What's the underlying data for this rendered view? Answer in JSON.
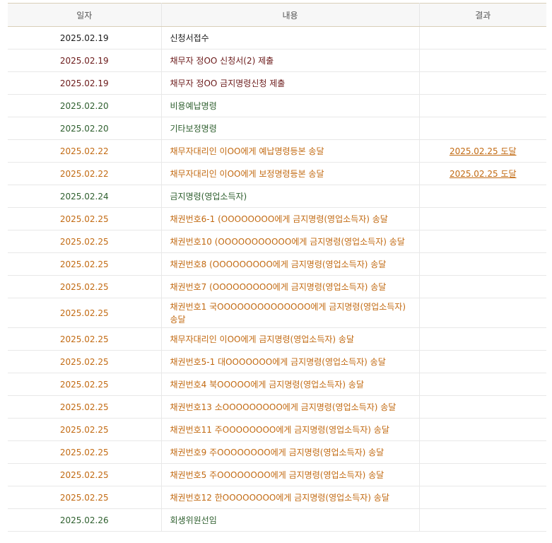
{
  "headers": {
    "date": "일자",
    "content": "내용",
    "result": "결과"
  },
  "colors": {
    "black": "#1c1c1c",
    "maroon": "#6b1a1a",
    "green": "#2e5f2e",
    "orange": "#c26a12"
  },
  "rows": [
    {
      "date": "2025.02.19",
      "content": "신청서접수",
      "result": "",
      "color": "#1c1c1c"
    },
    {
      "date": "2025.02.19",
      "content": "채무자 정OO 신청서(2) 제출",
      "result": "",
      "color": "#6b1a1a"
    },
    {
      "date": "2025.02.19",
      "content": "채무자 정OO 금지명령신청 제출",
      "result": "",
      "color": "#6b1a1a"
    },
    {
      "date": "2025.02.20",
      "content": "비용예납명령",
      "result": "",
      "color": "#2e5f2e"
    },
    {
      "date": "2025.02.20",
      "content": "기타보정명령",
      "result": "",
      "color": "#2e5f2e"
    },
    {
      "date": "2025.02.22",
      "content": "채무자대리인 이OO에게 예납명령등본 송달",
      "result": "2025.02.25 도달",
      "color": "#c26a12"
    },
    {
      "date": "2025.02.22",
      "content": "채무자대리인 이OO에게 보정명령등본 송달",
      "result": "2025.02.25 도달",
      "color": "#c26a12"
    },
    {
      "date": "2025.02.24",
      "content": "금지명령(영업소득자)",
      "result": "",
      "color": "#2e5f2e"
    },
    {
      "date": "2025.02.25",
      "content": "채권번호6-1 (OOOOOOOO에게 금지명령(영업소득자) 송달",
      "result": "",
      "color": "#c26a12"
    },
    {
      "date": "2025.02.25",
      "content": "채권번호10 (OOOOOOOOOOO에게 금지명령(영업소득자) 송달",
      "result": "",
      "color": "#c26a12"
    },
    {
      "date": "2025.02.25",
      "content": "채권번호8 (OOOOOOOOO에게 금지명령(영업소득자) 송달",
      "result": "",
      "color": "#c26a12"
    },
    {
      "date": "2025.02.25",
      "content": "채권번호7 (OOOOOOOOO에게 금지명령(영업소득자) 송달",
      "result": "",
      "color": "#c26a12"
    },
    {
      "date": "2025.02.25",
      "content": "채권번호1 국OOOOOOOOOOOOOO에게 금지명령(영업소득자) 송달",
      "result": "",
      "color": "#c26a12",
      "tall": true
    },
    {
      "date": "2025.02.25",
      "content": "채무자대리인 이OO에게 금지명령(영업소득자) 송달",
      "result": "",
      "color": "#c26a12"
    },
    {
      "date": "2025.02.25",
      "content": "채권번호5-1 대OOOOOOO에게 금지명령(영업소득자) 송달",
      "result": "",
      "color": "#c26a12"
    },
    {
      "date": "2025.02.25",
      "content": "채권번호4 북OOOOO에게 금지명령(영업소득자) 송달",
      "result": "",
      "color": "#c26a12"
    },
    {
      "date": "2025.02.25",
      "content": "채권번호13 소OOOOOOOOO에게 금지명령(영업소득자) 송달",
      "result": "",
      "color": "#c26a12"
    },
    {
      "date": "2025.02.25",
      "content": "채권번호11 주OOOOOOOO에게 금지명령(영업소득자) 송달",
      "result": "",
      "color": "#c26a12"
    },
    {
      "date": "2025.02.25",
      "content": "채권번호9 주OOOOOOOO에게 금지명령(영업소득자) 송달",
      "result": "",
      "color": "#c26a12"
    },
    {
      "date": "2025.02.25",
      "content": "채권번호5 주OOOOOOOO에게 금지명령(영업소득자) 송달",
      "result": "",
      "color": "#c26a12"
    },
    {
      "date": "2025.02.25",
      "content": "채권번호12 한OOOOOOOO에게 금지명령(영업소득자) 송달",
      "result": "",
      "color": "#c26a12"
    },
    {
      "date": "2025.02.26",
      "content": "회생위원선임",
      "result": "",
      "color": "#2e5f2e"
    }
  ]
}
